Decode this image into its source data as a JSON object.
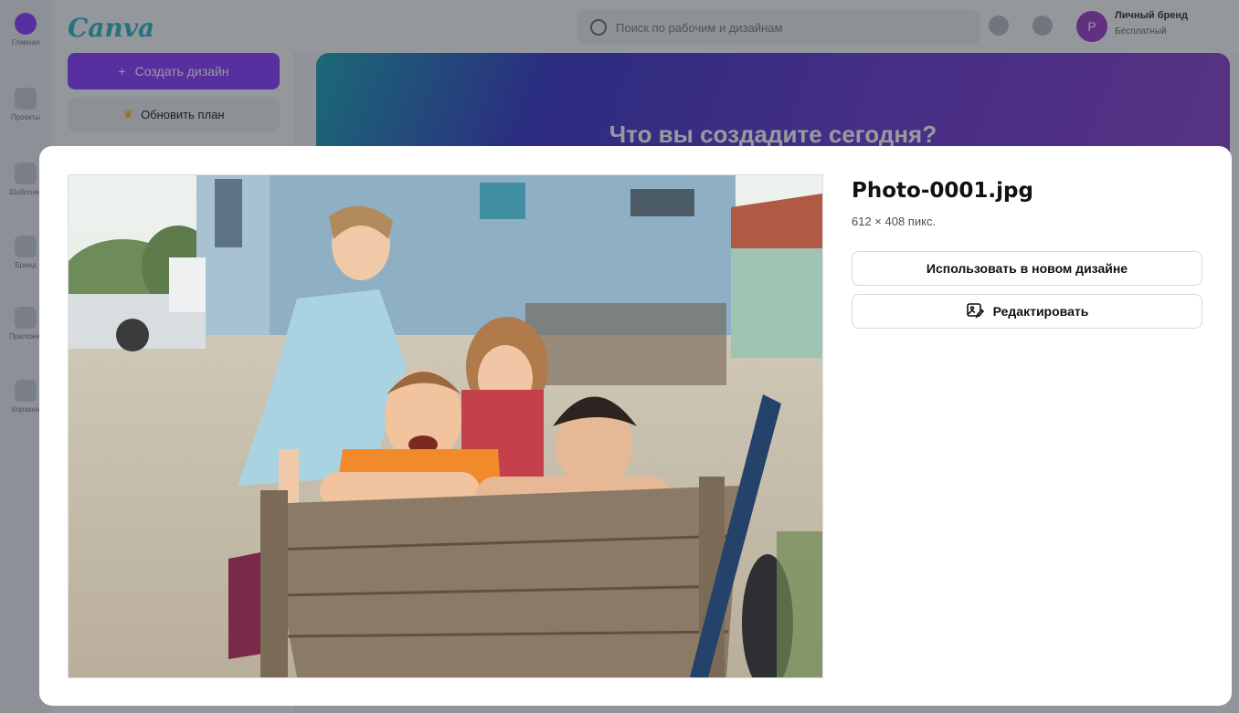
{
  "background": {
    "rail_items": [
      {
        "icon": "home-icon",
        "label": "Главная"
      },
      {
        "icon": "projects-icon",
        "label": "Проекты"
      },
      {
        "icon": "templates-icon",
        "label": "Шаблоны"
      },
      {
        "icon": "brand-icon",
        "label": "Бренд"
      },
      {
        "icon": "apps-icon",
        "label": "Приложения"
      },
      {
        "icon": "trash-icon",
        "label": "Корзина"
      }
    ],
    "logo": "Canva",
    "create_label": "Создать дизайн",
    "upgrade_label": "Обновить план",
    "search_placeholder": "Поиск по рабочим и дизайнам",
    "avatar_letter": "P",
    "account_name": "Личный бренд",
    "account_type": "Бесплатный",
    "banner_title": "Что вы создадите сегодня?"
  },
  "modal": {
    "filename": "Photo-0001.jpg",
    "dimensions": "612 × 408 пикс.",
    "use_in_design_label": "Использовать в новом дизайне",
    "edit_label": "Редактировать",
    "edit_icon": "image-edit-icon"
  },
  "colors": {
    "brand_purple": "#8b3dff",
    "logo_teal": "#2db9c9"
  }
}
